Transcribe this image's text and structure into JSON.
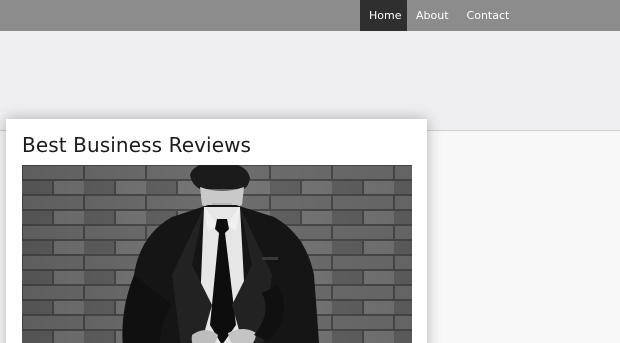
{
  "nav": {
    "items": [
      {
        "label": "Home",
        "active": true
      },
      {
        "label": "About",
        "active": false
      },
      {
        "label": "Contact",
        "active": false
      }
    ]
  },
  "post": {
    "title": "Best Business Reviews",
    "image": "businessman-in-suit-against-brick-wall-photo"
  },
  "colors": {
    "navbar": "#8c8c8c",
    "nav_active": "#2f2f2f",
    "hero": "#efeff1",
    "page_background": "#f8f8f8"
  }
}
